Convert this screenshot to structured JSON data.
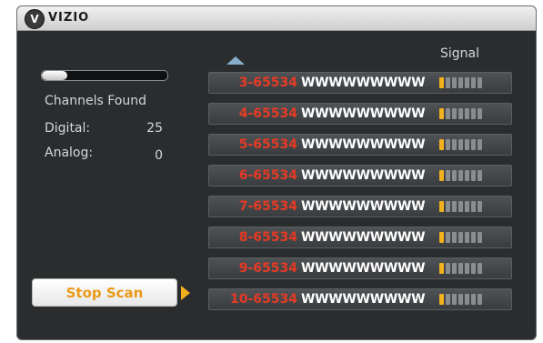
{
  "brand": {
    "logo_letter": "V",
    "name": "VIZIO"
  },
  "scan": {
    "progress": 0.2,
    "channels_found_label": "Channels Found",
    "digital_label": "Digital:",
    "digital_count": "25",
    "analog_label": "Analog:",
    "analog_count": "0",
    "stop_button_label": "Stop Scan"
  },
  "signal_header": "Signal",
  "channels": [
    {
      "number": "3-65534",
      "name": "WWWWWWWWW",
      "signal": 1,
      "max": 7
    },
    {
      "number": "4-65534",
      "name": "WWWWWWWWW",
      "signal": 1,
      "max": 7
    },
    {
      "number": "5-65534",
      "name": "WWWWWWWWW",
      "signal": 1,
      "max": 7
    },
    {
      "number": "6-65534",
      "name": "WWWWWWWWW",
      "signal": 1,
      "max": 7
    },
    {
      "number": "7-65534",
      "name": "WWWWWWWWW",
      "signal": 1,
      "max": 7
    },
    {
      "number": "8-65534",
      "name": "WWWWWWWWW",
      "signal": 1,
      "max": 7
    },
    {
      "number": "9-65534",
      "name": "WWWWWWWWW",
      "signal": 1,
      "max": 7
    },
    {
      "number": "10-65534",
      "name": "WWWWWWWWW",
      "signal": 1,
      "max": 7
    }
  ],
  "colors": {
    "channel_number": "#e53a24",
    "signal_active": "#f2b11f",
    "button_text": "#e99a18",
    "scroll_arrow": "#86aeca"
  },
  "icons": {
    "logo": "vizio-logo-icon",
    "scroll_up": "scroll-up-icon",
    "button_arrow": "arrow-right-icon"
  }
}
